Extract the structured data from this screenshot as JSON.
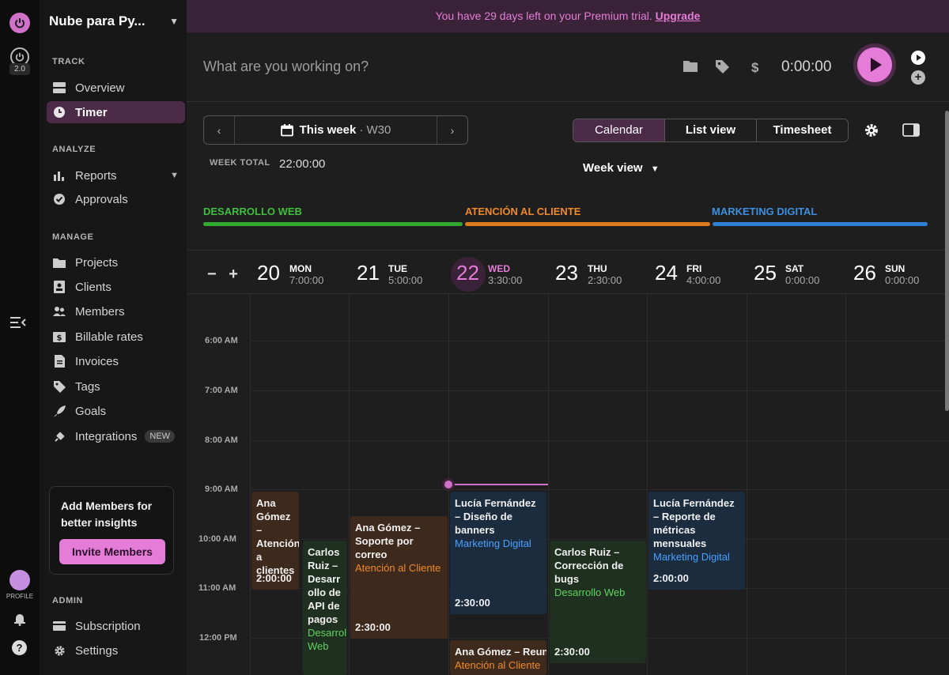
{
  "banner": {
    "text": "You have 29 days left on your Premium trial.",
    "link": "Upgrade"
  },
  "rail": {
    "version": "2.0",
    "profile_label": "PROFILE",
    "help": "?"
  },
  "workspace": {
    "name": "Nube para Py..."
  },
  "sidebar": {
    "track_label": "TRACK",
    "analyze_label": "ANALYZE",
    "manage_label": "MANAGE",
    "admin_label": "ADMIN",
    "items": {
      "overview": "Overview",
      "timer": "Timer",
      "reports": "Reports",
      "approvals": "Approvals",
      "projects": "Projects",
      "clients": "Clients",
      "members": "Members",
      "billable": "Billable rates",
      "invoices": "Invoices",
      "tags": "Tags",
      "goals": "Goals",
      "integrations": "Integrations",
      "integrations_badge": "NEW",
      "subscription": "Subscription",
      "settings": "Settings"
    },
    "promo": {
      "title": "Add Members for better insights",
      "button": "Invite Members"
    }
  },
  "timer": {
    "placeholder": "What are you working on?",
    "dollar": "$",
    "elapsed": "0:00:00"
  },
  "week": {
    "label": "This week",
    "week_num": "· W30",
    "total_label": "WEEK TOTAL",
    "total": "22:00:00"
  },
  "views": {
    "calendar": "Calendar",
    "list": "List view",
    "timesheet": "Timesheet",
    "week_view": "Week view"
  },
  "projects": [
    {
      "name": "DESARROLLO WEB",
      "color": "#3fbf3f"
    },
    {
      "name": "ATENCIÓN AL CLIENTE",
      "color": "#f0892a"
    },
    {
      "name": "MARKETING DIGITAL",
      "color": "#3d8fe0"
    }
  ],
  "zoom": {
    "minus": "−",
    "plus": "+"
  },
  "days": [
    {
      "num": "20",
      "name": "MON",
      "dur": "7:00:00"
    },
    {
      "num": "21",
      "name": "TUE",
      "dur": "5:00:00"
    },
    {
      "num": "22",
      "name": "WED",
      "dur": "3:30:00"
    },
    {
      "num": "23",
      "name": "THU",
      "dur": "2:30:00"
    },
    {
      "num": "24",
      "name": "FRI",
      "dur": "4:00:00"
    },
    {
      "num": "25",
      "name": "SAT",
      "dur": "0:00:00"
    },
    {
      "num": "26",
      "name": "SUN",
      "dur": "0:00:00"
    }
  ],
  "times": [
    "6:00 AM",
    "7:00 AM",
    "8:00 AM",
    "9:00 AM",
    "10:00 AM",
    "11:00 AM",
    "12:00 PM"
  ],
  "events": [
    {
      "title": "Ana Gómez – Atención a clientes",
      "project": "",
      "duration": "2:00:00"
    },
    {
      "title": "Carlos Ruiz – Desarrollo de API de pagos",
      "project": "Desarrollo Web",
      "duration": ""
    },
    {
      "title": "Ana Gómez – Soporte por correo",
      "project": "Atención al Cliente",
      "duration": "2:30:00"
    },
    {
      "title": "Lucía Fernández – Diseño de banners",
      "project": "Marketing Digital",
      "duration": "2:30:00"
    },
    {
      "title": "Ana Gómez – Reuni",
      "project": "Atención al Cliente",
      "duration": ""
    },
    {
      "title": "Carlos Ruiz – Corrección de bugs",
      "project": "Desarrollo Web",
      "duration": "2:30:00"
    },
    {
      "title": "Lucía Fernández – Reporte de métricas mensuales",
      "project": "Marketing Digital",
      "duration": "2:00:00"
    }
  ]
}
